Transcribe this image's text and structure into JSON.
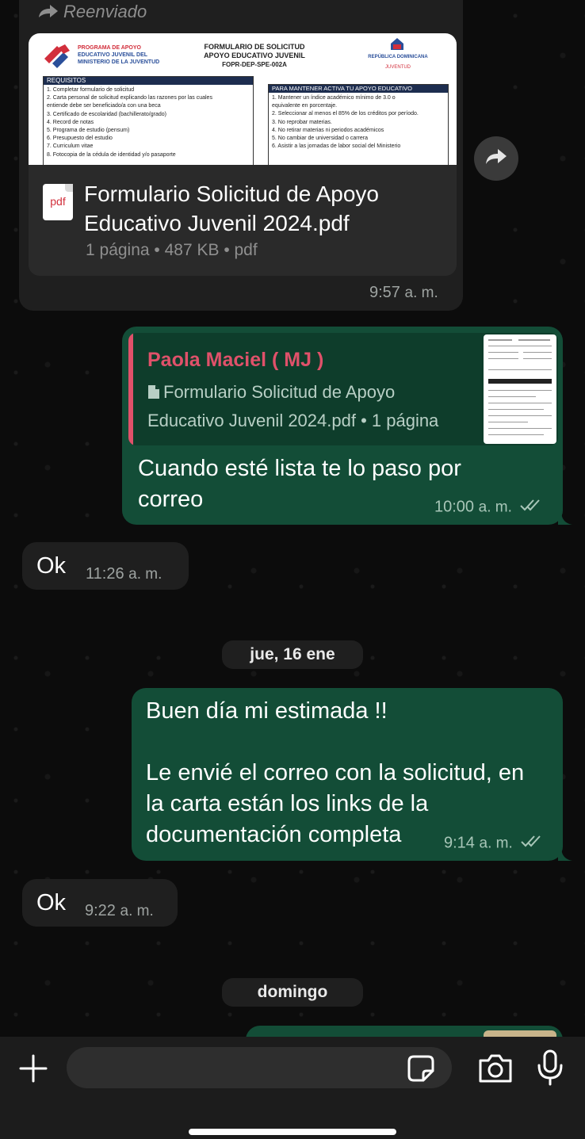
{
  "messages": {
    "forwarded_doc": {
      "forwarded_label": "Reenviado",
      "preview": {
        "org_line1": "PROGRAMA DE APOYO",
        "org_line2": "EDUCATIVO JUVENIL DEL",
        "org_line3": "MINISTERIO DE LA JUVENTUD",
        "title_line1": "FORMULARIO DE SOLICITUD",
        "title_line2": "APOYO EDUCATIVO JUVENIL",
        "code": "FOPR-DEP-SPE-002A",
        "gov_line1": "REPÚBLICA DOMINICANA",
        "gov_line2": "JUVENTUD",
        "req_header": "REQUISITOS",
        "req_items": [
          "1. Completar formulario de solicitud",
          "2. Carta personal de solicitud explicando las razones por las cuales",
          "entiende debe ser beneficiado/a con una beca",
          "3. Certificado de escolaridad (bachillerato/grado)",
          "4. Record de notas",
          "5. Programa de estudio (pensum)",
          "6. Presupuesto del estudio",
          "7. Curriculum vitae",
          "8. Fotocopia de la cédula de identidad y/o pasaporte"
        ],
        "keep_header": "PARA MANTENER ACTIVA TU APOYO EDUCATIVO",
        "keep_items": [
          "1. Mantener un índice académico mínimo de 3.0 o",
          "equivalente en porcentaje.",
          "2. Seleccionar al menos el 85% de los créditos por período.",
          "3. No reprobar materias.",
          "4. No retirar materias ni periodos académicos",
          "5. No cambiar de universidad o carrera",
          "6. Asistir a las jornadas de labor social del Ministerio"
        ]
      },
      "file_icon_label": "pdf",
      "file_name_line1": "Formulario Solicitud de Apoyo",
      "file_name_line2": "Educativo Juvenil 2024.pdf",
      "file_meta": "1 página • 487 KB • pdf",
      "time": "9:57",
      "ampm": "a. m."
    },
    "reply_out": {
      "quote_author": "Paola Maciel ( MJ )",
      "quote_line1": "Formulario Solicitud de Apoyo",
      "quote_line2": "Educativo Juvenil 2024.pdf • 1 página",
      "text_line1": "Cuando esté lista te lo paso por",
      "text_line2": "correo",
      "time": "10:00",
      "ampm": "a. m."
    },
    "ok1": {
      "text": "Ok",
      "time": "11:26",
      "ampm": "a. m."
    },
    "date_pill_1": "jue, 16 ene",
    "greeting_out": {
      "line1": "Buen día mi estimada !!",
      "line2": "Le envié el correo con la solicitud, en",
      "line3": "la carta están los links de la",
      "line4": "documentación completa",
      "time": "9:14",
      "ampm": "a. m."
    },
    "ok2": {
      "text": "Ok",
      "time": "9:22",
      "ampm": "a. m."
    },
    "date_pill_2": "domingo"
  },
  "composer": {
    "input_value": "",
    "icons": [
      "plus-icon",
      "sticker-icon",
      "camera-icon",
      "microphone-icon"
    ]
  },
  "colors": {
    "outgoing_bubble": "#134d37",
    "incoming_bubble": "#1f1f1f",
    "quote_author": "#e0516a",
    "read_ticks": "#a8c6b8"
  }
}
